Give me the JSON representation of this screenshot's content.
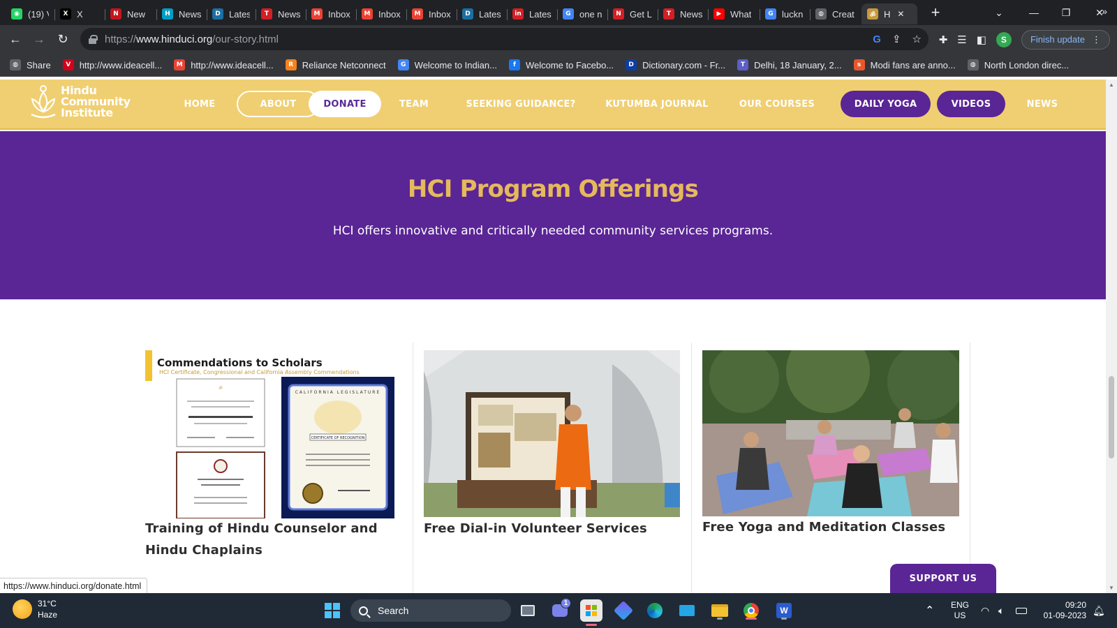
{
  "browser": {
    "tabs": [
      {
        "title": "(19) V",
        "icon": "whatsapp-icon",
        "color": "#25d366",
        "glyph": "◉"
      },
      {
        "title": "X",
        "icon": "x-icon",
        "color": "#000000",
        "glyph": "X"
      },
      {
        "title": "New",
        "icon": "ndtv-icon",
        "color": "#c4161c",
        "glyph": "N"
      },
      {
        "title": "News",
        "icon": "hc-icon",
        "color": "#00a0c6",
        "glyph": "H"
      },
      {
        "title": "Latest",
        "icon": "dh-icon",
        "color": "#1b6fa3",
        "glyph": "D"
      },
      {
        "title": "News",
        "icon": "toi-icon",
        "color": "#d31f26",
        "glyph": "T"
      },
      {
        "title": "Inbox",
        "icon": "gmail-icon",
        "color": "#ea4335",
        "glyph": "M"
      },
      {
        "title": "Inbox",
        "icon": "gmail-icon",
        "color": "#ea4335",
        "glyph": "M"
      },
      {
        "title": "Inbox",
        "icon": "gmail-icon",
        "color": "#ea4335",
        "glyph": "M"
      },
      {
        "title": "Latest",
        "icon": "dh-icon",
        "color": "#1b6fa3",
        "glyph": "D"
      },
      {
        "title": "Latest",
        "icon": "india-icon",
        "color": "#d31f26",
        "glyph": "in"
      },
      {
        "title": "one n",
        "icon": "google-icon",
        "color": "#4285f4",
        "glyph": "G"
      },
      {
        "title": "Get L",
        "icon": "news-icon",
        "color": "#d31f26",
        "glyph": "N"
      },
      {
        "title": "News",
        "icon": "toi-icon",
        "color": "#d31f26",
        "glyph": "T"
      },
      {
        "title": "What",
        "icon": "youtube-icon",
        "color": "#ff0000",
        "glyph": "▶"
      },
      {
        "title": "luckn",
        "icon": "google-icon",
        "color": "#4285f4",
        "glyph": "G"
      },
      {
        "title": "Creat",
        "icon": "globe-icon",
        "color": "#5f6368",
        "glyph": "◍"
      },
      {
        "title": "H",
        "icon": "hci-icon",
        "color": "#c99a3c",
        "glyph": "ॐ",
        "active": true
      }
    ],
    "url": {
      "prefix": "https://",
      "host": "www.hinduci.org",
      "path": "/our-story.html"
    },
    "profile_initial": "S",
    "finish_update": "Finish update",
    "bookmarks": [
      {
        "label": "Share",
        "icon": "share-icon",
        "color": "#5f6368",
        "glyph": "◍"
      },
      {
        "label": "http://www.ideacell...",
        "icon": "vi-icon",
        "color": "#d4001a",
        "glyph": "V"
      },
      {
        "label": "http://www.ideacell...",
        "icon": "gmail-icon",
        "color": "#ea4335",
        "glyph": "M"
      },
      {
        "label": "Reliance Netconnect",
        "icon": "reliance-icon",
        "color": "#f7821b",
        "glyph": "R"
      },
      {
        "label": "Welcome to Indian...",
        "icon": "google-icon",
        "color": "#4285f4",
        "glyph": "G"
      },
      {
        "label": "Welcome to Facebo...",
        "icon": "facebook-icon",
        "color": "#1877f2",
        "glyph": "f"
      },
      {
        "label": "Dictionary.com - Fr...",
        "icon": "dictionary-icon",
        "color": "#0e3da3",
        "glyph": "D"
      },
      {
        "label": "Delhi, 18 January, 2...",
        "icon": "teams-icon",
        "color": "#5b5fc7",
        "glyph": "T"
      },
      {
        "label": "Modi fans are anno...",
        "icon": "scroll-icon",
        "color": "#e8572b",
        "glyph": "s"
      },
      {
        "label": "North London direc...",
        "icon": "globe-icon",
        "color": "#5f6368",
        "glyph": "◍"
      }
    ],
    "status_url": "https://www.hinduci.org/donate.html"
  },
  "site": {
    "logo": {
      "line1": "Hindu",
      "line2": "Community",
      "line3": "Institute"
    },
    "nav": [
      {
        "label": "HOME",
        "style": "plain"
      },
      {
        "label": "ABOUT",
        "style": "outline"
      },
      {
        "label": "DONATE",
        "style": "white"
      },
      {
        "label": "TEAM",
        "style": "plain"
      },
      {
        "label": "SEEKING GUIDANCE?",
        "style": "plain"
      },
      {
        "label": "KUTUMBA JOURNAL",
        "style": "plain"
      },
      {
        "label": "OUR COURSES",
        "style": "plain"
      },
      {
        "label": "DAILY YOGA",
        "style": "purple"
      },
      {
        "label": "VIDEOS",
        "style": "purple"
      },
      {
        "label": "NEWS",
        "style": "plain"
      }
    ],
    "hero": {
      "title": "HCI Program Offerings",
      "subtitle": "HCI offers innovative and critically needed community services programs."
    },
    "cards": [
      {
        "title": "Training of Hindu Counselor and Hindu Chaplains",
        "image_heading": "Commendations to Scholars",
        "image_subheading": "HCI Certificate, Congressional and California Assembly Commendations",
        "image_cert_label": "CERTIFICATE OF RECOGNITION",
        "image_legislature_label": "CALIFORNIA LEGISLATURE"
      },
      {
        "title": "Free Dial-in Volunteer Services"
      },
      {
        "title": "Free Yoga and Meditation Classes"
      }
    ],
    "support_button": "SUPPORT US"
  },
  "taskbar": {
    "weather": {
      "temp": "31°C",
      "condition": "Haze"
    },
    "search_label": "Search",
    "teams_badge": "1",
    "lang": {
      "line1": "ENG",
      "line2": "US"
    },
    "time": "09:20",
    "date": "01-09-2023"
  },
  "colors": {
    "header_gold": "#f0cf72",
    "brand_purple": "#5a2595",
    "hero_title_gold": "#e5b95c"
  }
}
